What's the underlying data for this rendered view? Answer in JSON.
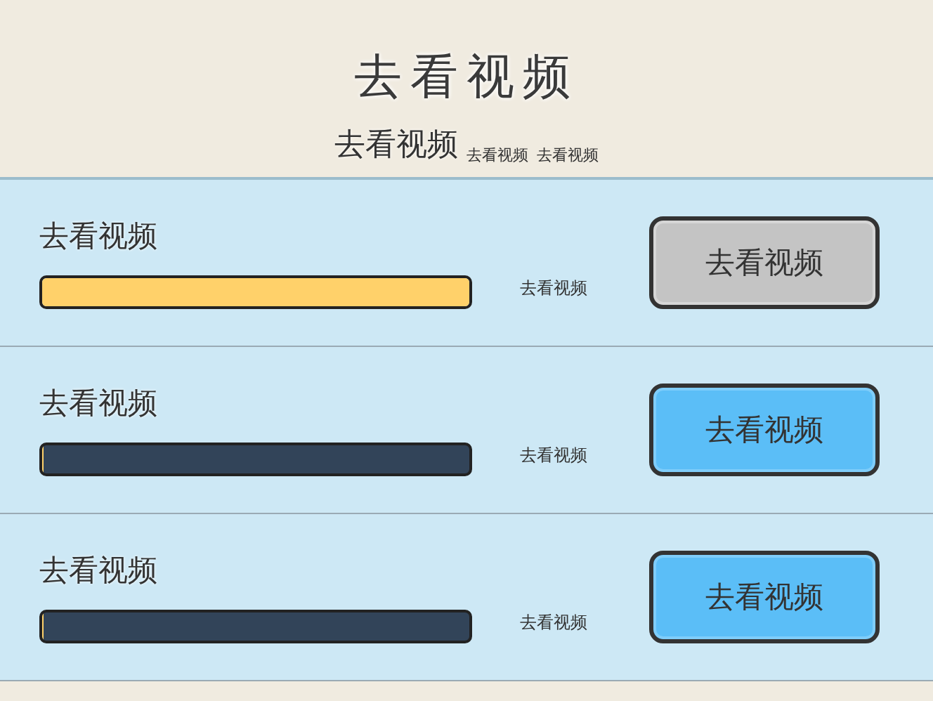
{
  "header": {
    "title": "去看视频",
    "subtitle": "去看视频",
    "notes": [
      "去看视频",
      "去看视频"
    ]
  },
  "tasks": [
    {
      "label": "去看视频",
      "level": 1,
      "reading": "去看视频",
      "button": "去看视频",
      "disabled": true
    },
    {
      "label": "去看视频",
      "level": 0,
      "reading": "去看视频",
      "button": "去看视频",
      "disabled": false
    },
    {
      "label": "去看视频",
      "level": 0,
      "reading": "去看视频",
      "button": "去看视频",
      "disabled": false
    }
  ]
}
